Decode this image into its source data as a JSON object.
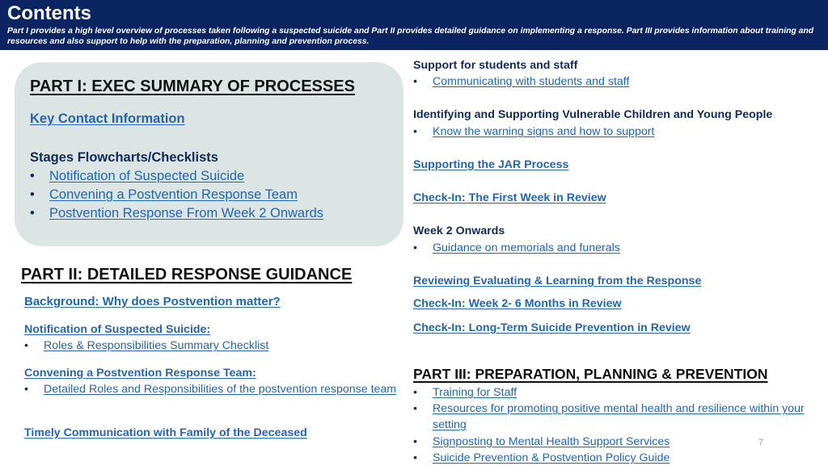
{
  "header": {
    "title": "Contents",
    "subtitle": "Part I provides a high level overview of processes taken following a suspected suicide and Part II provides detailed guidance on implementing a response.  Part III provides information about training and resources and also support to help with the preparation, planning and prevention process."
  },
  "part1": {
    "heading": "PART I: EXEC SUMMARY OF PROCESSES",
    "key_contact": "Key Contact Information",
    "stages_heading": "Stages Flowcharts/Checklists",
    "stages_items": [
      "Notification of Suspected Suicide",
      "Convening a Postvention Response Team",
      "Postvention Response From Week 2 Onwards"
    ]
  },
  "part2": {
    "heading": "PART II: DETAILED RESPONSE GUIDANCE",
    "background": "Background: Why does Postvention matter?",
    "notification_heading": "Notification of Suspected Suicide:",
    "notification_items": [
      "Roles & Responsibilities Summary Checklist"
    ],
    "convening_heading": "Convening a Postvention Response Team:",
    "convening_items": [
      "Detailed Roles and Responsibilities of the postvention response team"
    ],
    "family": "Timely Communication with Family of the Deceased",
    "support_heading": "Support for students and staff",
    "support_items": [
      "Communicating with students and staff"
    ],
    "vulnerable_heading": "Identifying and Supporting Vulnerable Children and Young People",
    "vulnerable_items": [
      "Know the warning signs and how to support"
    ],
    "jar": "Supporting the JAR Process",
    "first_week": "Check-In: The First Week in Review",
    "week2_heading": "Week 2 Onwards",
    "week2_items": [
      "Guidance on memorials and funerals"
    ],
    "reviewing": "Reviewing Evaluating & Learning from the Response",
    "six_months": "Check-In: Week 2- 6 Months in Review",
    "long_term": "Check-In: Long-Term Suicide Prevention in Review"
  },
  "part3": {
    "heading": "PART III:  PREPARATION, PLANNING & PREVENTION",
    "items": [
      "Training for Staff",
      "Resources for promoting positive mental health and resilience within your setting",
      "Signposting to Mental Health Support Services",
      "Suicide Prevention & Postvention Policy Guide"
    ]
  },
  "bullet_char": "•",
  "page_number": "7",
  "colors": {
    "header_bg": "#0a2462",
    "box_bg": "#dce5e4",
    "link": "#1f66b5",
    "subheading": "#0f2a5c"
  }
}
